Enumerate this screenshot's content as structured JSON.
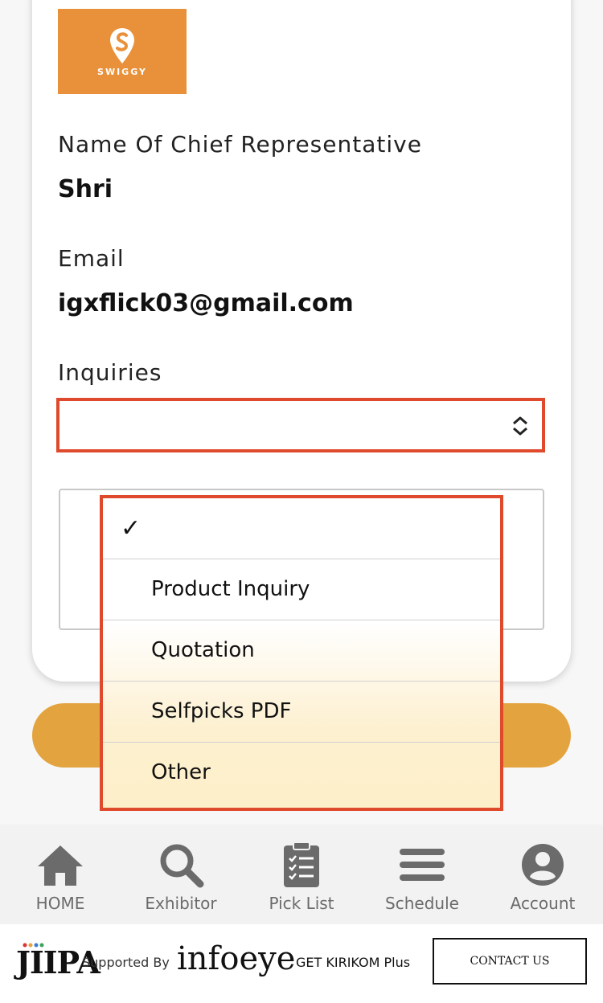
{
  "brand": {
    "name": "SWIGGY",
    "color": "#e9913a"
  },
  "fields": {
    "chief_label": "Name Of Chief Representative",
    "chief_value": "Shri",
    "email_label": "Email",
    "email_value": "igxflick03@gmail.com",
    "inquiries_label": "Inquiries",
    "inquiries_value": ""
  },
  "dropdown": {
    "selected_mark": "✓",
    "options": [
      "",
      "Product Inquiry",
      "Quotation",
      "Selfpicks PDF",
      "Other"
    ]
  },
  "nav": {
    "items": [
      {
        "label": "HOME",
        "icon": "home-icon"
      },
      {
        "label": "Exhibitor",
        "icon": "search-icon"
      },
      {
        "label": "Pick List",
        "icon": "clipboard-icon"
      },
      {
        "label": "Schedule",
        "icon": "menu-icon"
      },
      {
        "label": "Account",
        "icon": "account-icon"
      }
    ]
  },
  "footer": {
    "jiipa": "JIIPA",
    "supported_by": "Supported By",
    "infoeye": "infoeye",
    "kirikom": "GET KIRIKOM Plus",
    "contact_label": "CONTACT US"
  },
  "colors": {
    "highlight": "#e04a2c",
    "submit": "#e3a33f",
    "nav_icon": "#6b6b6b"
  }
}
